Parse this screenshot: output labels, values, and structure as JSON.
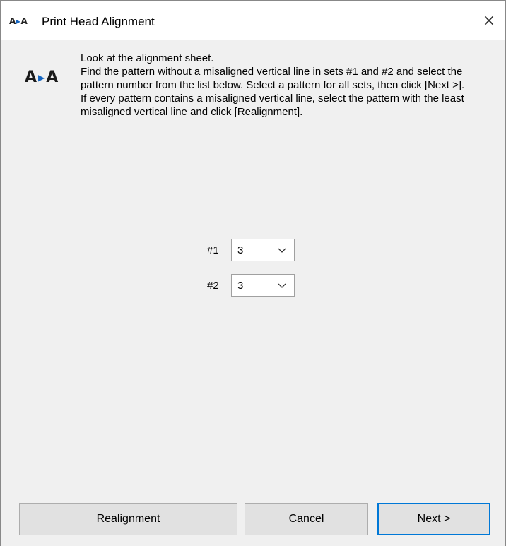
{
  "window": {
    "title": "Print Head Alignment",
    "app_icon": "aa-align-icon",
    "close_glyph": "×"
  },
  "instructions": {
    "line1": "Look at the alignment sheet.",
    "line2": "Find the pattern without a misaligned vertical line in sets #1 and #2 and select the pattern number from the list below. Select a pattern for all sets, then click [Next >].",
    "line3": "If every pattern contains a misaligned vertical line, select the pattern with the least misaligned vertical line and click [Realignment]."
  },
  "icon_glyph": {
    "left": "A",
    "right": "A"
  },
  "patterns": [
    {
      "label": "#1",
      "value": "3"
    },
    {
      "label": "#2",
      "value": "3"
    }
  ],
  "buttons": {
    "realignment": "Realignment",
    "cancel": "Cancel",
    "next": "Next >"
  },
  "colors": {
    "accent": "#0078d7",
    "icon_arrow": "#1565c0",
    "dialog_bg": "#f0f0f0"
  }
}
